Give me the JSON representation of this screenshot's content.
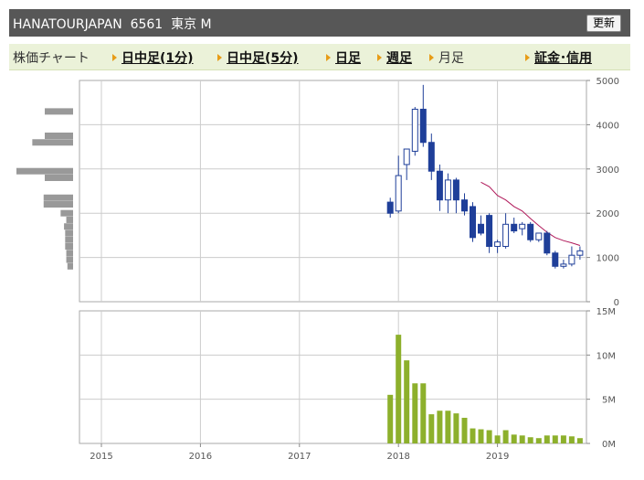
{
  "header": {
    "title": "HANATOURJAPAN  6561  東京 M",
    "refresh_label": "更新"
  },
  "nav": {
    "items": [
      {
        "label": "株価チャート",
        "link": false
      },
      {
        "label": "日中足(1分)",
        "link": true
      },
      {
        "label": "日中足(5分)",
        "link": true
      },
      {
        "label": "日足",
        "link": true
      },
      {
        "label": "週足",
        "link": true
      },
      {
        "label": "月足",
        "link": false
      },
      {
        "label": "証金･信用",
        "link": true
      }
    ]
  },
  "colors": {
    "accent_arrow": "#e79c17",
    "bearish_fill": "#1f3f99",
    "bullish_fill": "#ffffff",
    "candle_outline": "#1f3f99",
    "ma_line": "#b0195a",
    "volume_bar": "#8db02c",
    "volume_profile": "#999999",
    "grid": "#cccccc"
  },
  "chart_data": [
    {
      "type": "candlestick",
      "y_ticks": [
        "5000",
        "4000",
        "3000",
        "2000",
        "1000",
        "0"
      ],
      "ylim": [
        0,
        5000
      ],
      "x_ticks": [
        "2015",
        "2016",
        "2017",
        "2018",
        "2019"
      ],
      "candles": [
        {
          "x": 2017.917,
          "open": 2250,
          "high": 2350,
          "low": 1900,
          "close": 2000
        },
        {
          "x": 2018.0,
          "open": 2050,
          "high": 3300,
          "low": 2000,
          "close": 2850
        },
        {
          "x": 2018.083,
          "open": 3100,
          "high": 3450,
          "low": 2750,
          "close": 3450
        },
        {
          "x": 2018.167,
          "open": 3400,
          "high": 4400,
          "low": 3300,
          "close": 4350
        },
        {
          "x": 2018.25,
          "open": 4350,
          "high": 4900,
          "low": 3500,
          "close": 3600
        },
        {
          "x": 2018.333,
          "open": 3600,
          "high": 3800,
          "low": 2750,
          "close": 2950
        },
        {
          "x": 2018.417,
          "open": 2950,
          "high": 3100,
          "low": 2050,
          "close": 2300
        },
        {
          "x": 2018.5,
          "open": 2300,
          "high": 2900,
          "low": 2000,
          "close": 2750
        },
        {
          "x": 2018.583,
          "open": 2750,
          "high": 2800,
          "low": 2000,
          "close": 2300
        },
        {
          "x": 2018.667,
          "open": 2300,
          "high": 2450,
          "low": 1950,
          "close": 2050
        },
        {
          "x": 2018.75,
          "open": 2150,
          "high": 2250,
          "low": 1350,
          "close": 1450
        },
        {
          "x": 2018.833,
          "open": 1750,
          "high": 1950,
          "low": 1500,
          "close": 1550
        },
        {
          "x": 2018.917,
          "open": 1950,
          "high": 2000,
          "low": 1100,
          "close": 1250
        },
        {
          "x": 2019.0,
          "open": 1250,
          "high": 1400,
          "low": 1100,
          "close": 1350
        },
        {
          "x": 2019.083,
          "open": 1250,
          "high": 2000,
          "low": 1200,
          "close": 1750
        },
        {
          "x": 2019.167,
          "open": 1750,
          "high": 1900,
          "low": 1550,
          "close": 1600
        },
        {
          "x": 2019.25,
          "open": 1650,
          "high": 1800,
          "low": 1500,
          "close": 1750
        },
        {
          "x": 2019.333,
          "open": 1750,
          "high": 1800,
          "low": 1350,
          "close": 1400
        },
        {
          "x": 2019.417,
          "open": 1400,
          "high": 1550,
          "low": 1350,
          "close": 1550
        },
        {
          "x": 2019.5,
          "open": 1550,
          "high": 1600,
          "low": 1050,
          "close": 1100
        },
        {
          "x": 2019.583,
          "open": 1100,
          "high": 1150,
          "low": 750,
          "close": 800
        },
        {
          "x": 2019.667,
          "open": 800,
          "high": 950,
          "low": 750,
          "close": 850
        },
        {
          "x": 2019.75,
          "open": 850,
          "high": 1250,
          "low": 800,
          "close": 1050
        },
        {
          "x": 2019.833,
          "open": 1050,
          "high": 1250,
          "low": 950,
          "close": 1150
        }
      ],
      "moving_average": [
        {
          "x": 2018.833,
          "y": 2700
        },
        {
          "x": 2018.917,
          "y": 2600
        },
        {
          "x": 2019.0,
          "y": 2400
        },
        {
          "x": 2019.083,
          "y": 2300
        },
        {
          "x": 2019.167,
          "y": 2150
        },
        {
          "x": 2019.25,
          "y": 2050
        },
        {
          "x": 2019.333,
          "y": 1880
        },
        {
          "x": 2019.417,
          "y": 1720
        },
        {
          "x": 2019.5,
          "y": 1570
        },
        {
          "x": 2019.583,
          "y": 1450
        },
        {
          "x": 2019.667,
          "y": 1380
        },
        {
          "x": 2019.75,
          "y": 1330
        },
        {
          "x": 2019.833,
          "y": 1270
        }
      ],
      "volume_profile": [
        {
          "price": 4300,
          "volume": 0.5
        },
        {
          "price": 3750,
          "volume": 0.5
        },
        {
          "price": 3600,
          "volume": 0.72
        },
        {
          "price": 2950,
          "volume": 1.0
        },
        {
          "price": 2800,
          "volume": 0.5
        },
        {
          "price": 2350,
          "volume": 0.52
        },
        {
          "price": 2200,
          "volume": 0.52
        },
        {
          "price": 2000,
          "volume": 0.22
        },
        {
          "price": 1850,
          "volume": 0.12
        },
        {
          "price": 1700,
          "volume": 0.16
        },
        {
          "price": 1550,
          "volume": 0.14
        },
        {
          "price": 1400,
          "volume": 0.14
        },
        {
          "price": 1250,
          "volume": 0.14
        },
        {
          "price": 1100,
          "volume": 0.12
        },
        {
          "price": 950,
          "volume": 0.12
        },
        {
          "price": 800,
          "volume": 0.1
        }
      ]
    },
    {
      "type": "bar",
      "y_ticks": [
        "15M",
        "10M",
        "5M",
        "0M"
      ],
      "ylim": [
        0,
        15000000
      ],
      "x_ticks": [
        "2015",
        "2016",
        "2017",
        "2018",
        "2019"
      ],
      "x": [
        2017.917,
        2018.0,
        2018.083,
        2018.167,
        2018.25,
        2018.333,
        2018.417,
        2018.5,
        2018.583,
        2018.667,
        2018.75,
        2018.833,
        2018.917,
        2019.0,
        2019.083,
        2019.167,
        2019.25,
        2019.333,
        2019.417,
        2019.5,
        2019.583,
        2019.667,
        2019.75,
        2019.833
      ],
      "values": [
        5500000,
        12300000,
        9400000,
        6800000,
        6800000,
        3300000,
        3700000,
        3700000,
        3400000,
        2900000,
        1700000,
        1600000,
        1500000,
        900000,
        1500000,
        1000000,
        900000,
        700000,
        600000,
        900000,
        900000,
        900000,
        800000,
        600000
      ]
    }
  ]
}
